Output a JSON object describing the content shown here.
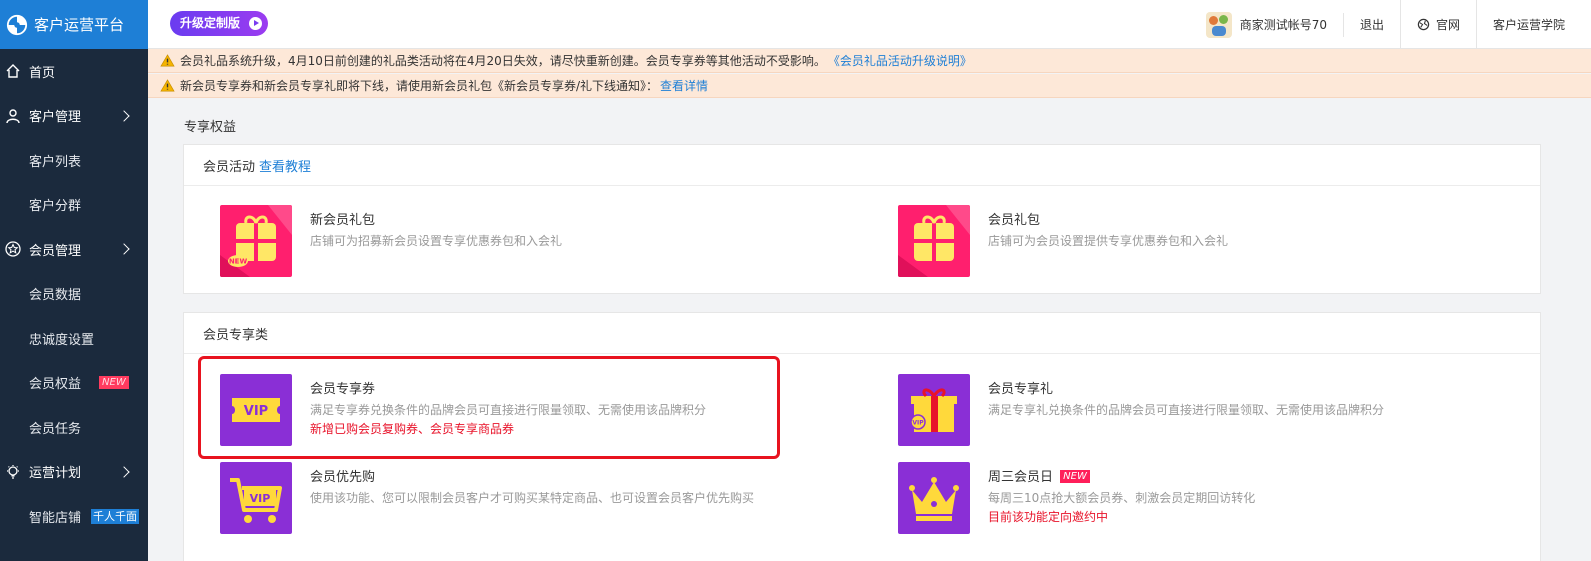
{
  "brand": {
    "title": "客户运营平台"
  },
  "upgrade_badge": "升级定制版",
  "header": {
    "account": "商家测试帐号70",
    "logout": "退出",
    "official_site": "官网",
    "academy": "客户运营学院"
  },
  "sidebar": {
    "items": [
      {
        "label": "首页",
        "icon": "home-icon"
      },
      {
        "label": "客户管理",
        "icon": "user-icon"
      },
      {
        "label": "客户列表"
      },
      {
        "label": "客户分群"
      },
      {
        "label": "会员管理",
        "icon": "star-icon"
      },
      {
        "label": "会员数据"
      },
      {
        "label": "忠诚度设置"
      },
      {
        "label": "会员权益",
        "tag": "NEW"
      },
      {
        "label": "会员任务"
      },
      {
        "label": "运营计划",
        "icon": "bulb-icon"
      },
      {
        "label": "智能店铺",
        "tag": "千人千面"
      }
    ]
  },
  "notices": [
    {
      "text": "会员礼品系统升级，4月10日前创建的礼品类活动将在4月20日失效，请尽快重新创建。会员专享券等其他活动不受影响。",
      "link": "《会员礼品活动升级说明》"
    },
    {
      "text": "新会员专享券和新会员专享礼即将下线，请使用新会员礼包《新会员专享券/礼下线通知》：",
      "link": "查看详情"
    }
  ],
  "main": {
    "section_title": "专享权益",
    "panels": [
      {
        "title": "会员活动",
        "link": "查看教程",
        "cards": [
          {
            "title": "新会员礼包",
            "desc": "店铺可为招募新会员设置专享优惠券包和入会礼",
            "thumb": "gift-pack-new-icon"
          },
          {
            "title": "会员礼包",
            "desc": "店铺可为会员设置提供专享优惠券包和入会礼",
            "thumb": "gift-pack-icon"
          }
        ]
      },
      {
        "title": "会员专享类",
        "cards": [
          {
            "title": "会员专享券",
            "desc": "满足专享券兑换条件的品牌会员可直接进行限量领取、无需使用该品牌积分",
            "note": "新增已购会员复购券、会员专享商品券",
            "thumb": "vip-ticket-icon"
          },
          {
            "title": "会员专享礼",
            "desc": "满足专享礼兑换条件的品牌会员可直接进行限量领取、无需使用该品牌积分",
            "thumb": "vip-gift-icon"
          },
          {
            "title": "会员优先购",
            "desc": "使用该功能、您可以限制会员客户才可购买某特定商品、也可设置会员客户优先购买",
            "thumb": "vip-cart-icon"
          },
          {
            "title": "周三会员日",
            "tag": "NEW",
            "desc": "每周三10点抢大额会员券、刺激会员定期回访转化",
            "note": "目前该功能定向邀约中",
            "thumb": "crown-icon"
          }
        ]
      }
    ]
  },
  "colors": {
    "brand_blue": "#1e7fd6",
    "sidebar_bg": "#1b2a3d",
    "notice_bg": "#fde8d8",
    "gift_pink": "#ff1f6e",
    "vip_purple": "#8a2fd6",
    "alert_red": "#e8132a"
  }
}
